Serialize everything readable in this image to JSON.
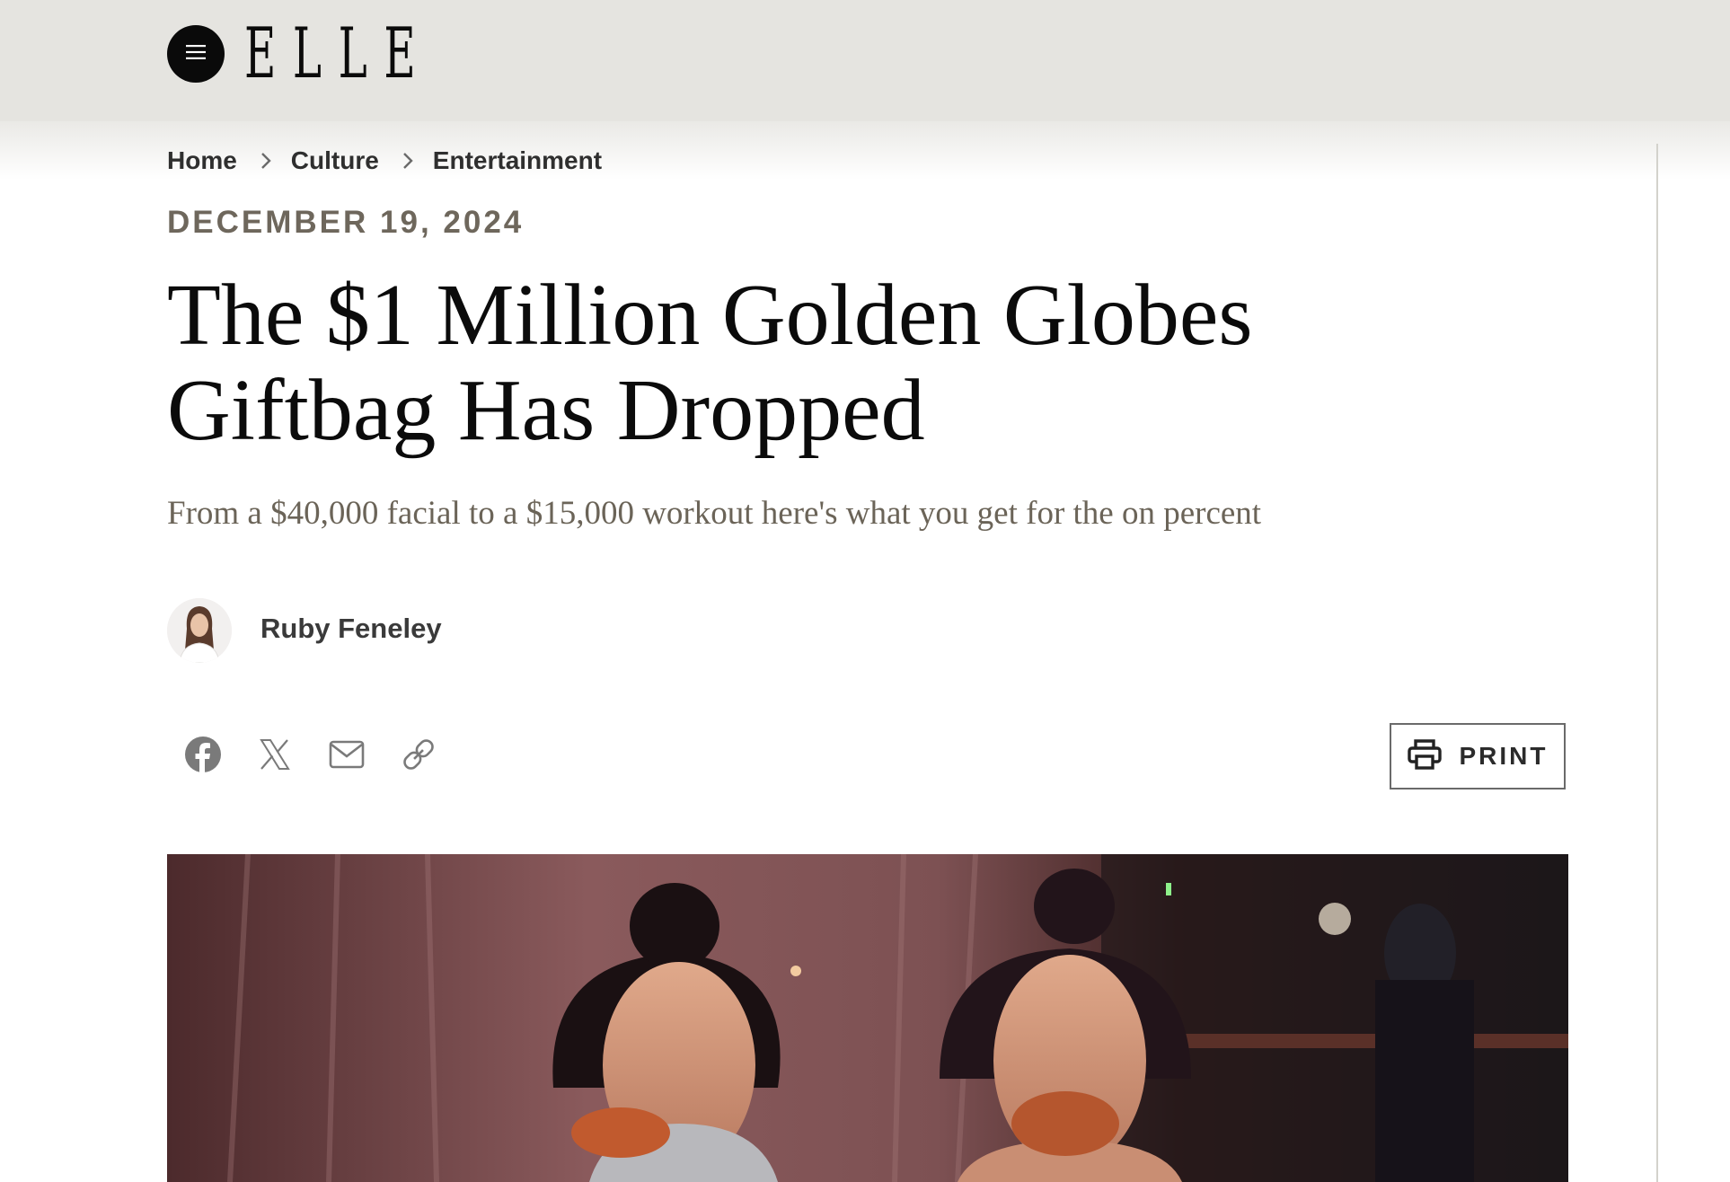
{
  "header": {
    "logo_text": "ELLE",
    "menu_icon": "hamburger-icon"
  },
  "breadcrumb": {
    "items": [
      "Home",
      "Culture",
      "Entertainment"
    ],
    "separator_icon": "chevron-right-icon"
  },
  "article": {
    "date": "DECEMBER 19, 2024",
    "title_line1": "The $1 Million Golden Globes",
    "title_line2": "Giftbag Has Dropped",
    "dek": "From a $40,000 facial to a $15,000 workout here's what you get for the on percent",
    "author": "Ruby Feneley"
  },
  "share": {
    "icons": [
      "facebook-icon",
      "x-icon",
      "email-icon",
      "link-icon"
    ]
  },
  "print": {
    "label": "PRINT",
    "icon": "printer-icon"
  },
  "colors": {
    "header_bg": "#e5e4e0",
    "date": "#6e675c",
    "dek": "#6b6458",
    "share_icon": "#7a7a7a"
  }
}
